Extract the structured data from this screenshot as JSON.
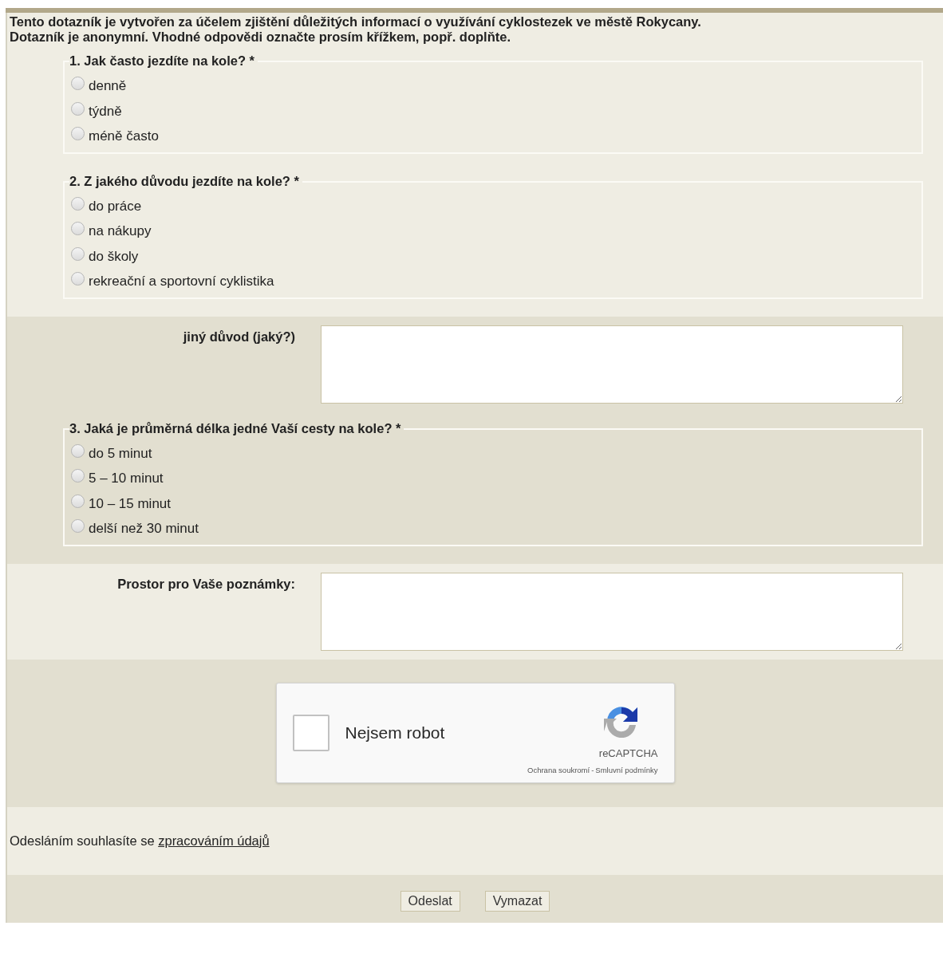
{
  "intro": [
    "Tento dotazník je vytvořen za účelem zjištění důležitých informací o využívání cyklostezek ve městě Rokycany.",
    "Dotazník je anonymní. Vhodné odpovědi označte prosím křížkem, popř. doplňte."
  ],
  "questions": [
    {
      "title": "1. Jak často jezdíte na kole? *",
      "options": [
        {
          "label": "denně",
          "selected": false
        },
        {
          "label": "týdně",
          "selected": false
        },
        {
          "label": "méně často",
          "selected": false
        }
      ]
    },
    {
      "title": "2. Z jakého důvodu jezdíte na kole? *",
      "options": [
        {
          "label": "do práce",
          "selected": false
        },
        {
          "label": "na nákupy",
          "selected": false
        },
        {
          "label": "do školy",
          "selected": false
        },
        {
          "label": "rekreační a sportovní cyklistika",
          "selected": false
        }
      ]
    },
    {
      "title": "3. Jaká je průměrná délka jedné Vaší cesty na kole? *",
      "options": [
        {
          "label": "do 5 minut",
          "selected": false
        },
        {
          "label": "5 – 10 minut",
          "selected": false
        },
        {
          "label": "10 – 15 minut",
          "selected": false
        },
        {
          "label": "delší než 30 minut",
          "selected": false
        }
      ]
    }
  ],
  "other_reason": {
    "label": "jiný důvod (jaký?)"
  },
  "notes": {
    "label": "Prostor pro Vaše poznámky:"
  },
  "captcha": {
    "label": "Nejsem robot",
    "checked": false,
    "brand": "reCAPTCHA",
    "links": [
      "Ochrana soukromí",
      "Smluvní podmínky"
    ],
    "separator": "-"
  },
  "consent": {
    "text": "Odesláním souhlasíte se",
    "link": "zpracováním údajů"
  },
  "buttons": [
    "Odeslat",
    "Vymazat"
  ]
}
